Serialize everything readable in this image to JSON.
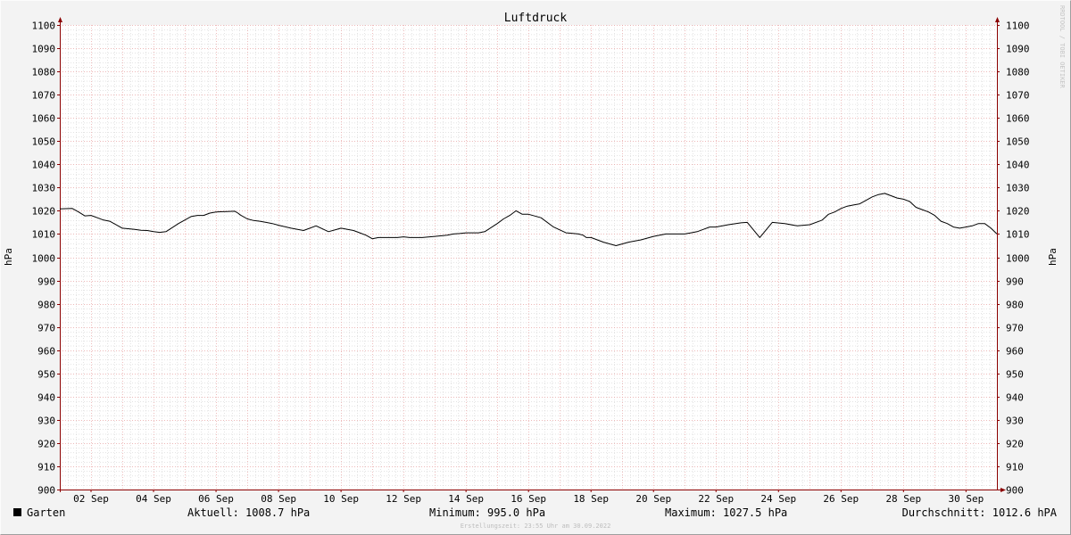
{
  "chart_data": {
    "type": "line",
    "title": "Luftdruck",
    "ylabel": "hPa",
    "ylabel_right": "hPa",
    "ylim": [
      900,
      1100
    ],
    "y_ticks": [
      900,
      910,
      920,
      930,
      940,
      950,
      960,
      970,
      980,
      990,
      1000,
      1010,
      1020,
      1030,
      1040,
      1050,
      1060,
      1070,
      1080,
      1090,
      1100
    ],
    "x_ticks": [
      "02 Sep",
      "04 Sep",
      "06 Sep",
      "08 Sep",
      "10 Sep",
      "12 Sep",
      "14 Sep",
      "16 Sep",
      "18 Sep",
      "20 Sep",
      "22 Sep",
      "24 Sep",
      "26 Sep",
      "28 Sep",
      "30 Sep"
    ],
    "x_tick_days": [
      2,
      4,
      6,
      8,
      10,
      12,
      14,
      16,
      18,
      20,
      22,
      24,
      26,
      28,
      30
    ],
    "xlim_days": [
      1.0,
      30.99
    ],
    "grid": true,
    "colors": {
      "line": "#000000",
      "major_grid": "#e8a2a2",
      "minor_grid": "#c8c8c8",
      "axis": "#8b0000",
      "plot_bg": "#ffffff",
      "canvas_bg": "#f3f3f3"
    },
    "series": [
      {
        "name": "Garten",
        "day": [
          1.0,
          1.4,
          1.6,
          1.8,
          2.0,
          2.2,
          2.4,
          2.6,
          3.0,
          3.4,
          3.6,
          3.8,
          4.0,
          4.2,
          4.4,
          4.8,
          5.2,
          5.4,
          5.6,
          5.8,
          6.0,
          6.2,
          6.6,
          6.7,
          6.75,
          6.8,
          7.0,
          7.2,
          7.4,
          7.6,
          7.8,
          8.0,
          8.4,
          8.8,
          9.2,
          9.6,
          10.0,
          10.4,
          10.6,
          10.8,
          11.0,
          11.2,
          11.4,
          11.6,
          11.8,
          12.0,
          12.2,
          12.4,
          12.6,
          12.8,
          13.0,
          13.4,
          13.6,
          13.8,
          14.0,
          14.2,
          14.4,
          14.6,
          15.0,
          15.2,
          15.4,
          15.6,
          15.8,
          16.0,
          16.4,
          16.8,
          17.2,
          17.6,
          17.75,
          17.8,
          17.85,
          18.0,
          18.4,
          18.8,
          19.2,
          19.6,
          20.0,
          20.4,
          20.8,
          21.0,
          21.2,
          21.4,
          21.6,
          21.8,
          22.0,
          22.4,
          22.8,
          23.0,
          23.4,
          23.8,
          24.2,
          24.6,
          25.0,
          25.4,
          25.6,
          25.8,
          26.0,
          26.2,
          26.4,
          26.6,
          26.8,
          27.0,
          27.2,
          27.4,
          27.6,
          27.8,
          28.0,
          28.2,
          28.4,
          28.6,
          28.8,
          29.0,
          29.2,
          29.4,
          29.6,
          29.8,
          30.0,
          30.2,
          30.4,
          30.6,
          30.8,
          30.99
        ],
        "values": [
          1020.8,
          1021.0,
          1019.5,
          1017.8,
          1018.0,
          1017.0,
          1016.0,
          1015.5,
          1012.5,
          1012.0,
          1011.6,
          1011.5,
          1011.0,
          1010.7,
          1011.0,
          1014.5,
          1017.5,
          1018.0,
          1018.0,
          1019.0,
          1019.5,
          1019.6,
          1019.8,
          1019.0,
          1018.5,
          1018.0,
          1016.5,
          1015.8,
          1015.5,
          1015.0,
          1014.5,
          1013.8,
          1012.5,
          1011.5,
          1013.5,
          1011.0,
          1012.5,
          1011.5,
          1010.5,
          1009.5,
          1008.0,
          1008.5,
          1008.5,
          1008.5,
          1008.5,
          1008.8,
          1008.5,
          1008.5,
          1008.5,
          1008.7,
          1009.0,
          1009.5,
          1010.0,
          1010.2,
          1010.5,
          1010.5,
          1010.5,
          1011.0,
          1014.5,
          1016.5,
          1018.0,
          1020.0,
          1018.5,
          1018.5,
          1017.0,
          1013.0,
          1010.5,
          1010.0,
          1009.5,
          1009.0,
          1008.5,
          1008.5,
          1006.5,
          1005.0,
          1006.5,
          1007.5,
          1009.0,
          1010.0,
          1010.0,
          1010.0,
          1010.5,
          1011.0,
          1012.0,
          1013.0,
          1013.0,
          1014.0,
          1014.8,
          1015.0,
          1008.5,
          1015.0,
          1014.5,
          1013.5,
          1014.0,
          1016.0,
          1018.5,
          1019.5,
          1021.0,
          1022.0,
          1022.5,
          1023.0,
          1024.5,
          1026.0,
          1027.0,
          1027.5,
          1026.5,
          1025.5,
          1025.0,
          1024.0,
          1021.5,
          1020.5,
          1019.5,
          1018.0,
          1015.5,
          1014.5,
          1013.0,
          1012.5,
          1013.0,
          1013.5,
          1014.5,
          1014.5,
          1012.5,
          1010.0
        ]
      }
    ],
    "legend": {
      "series_label": "Garten",
      "stats": [
        "Aktuell: 1008.7 hPa",
        "Minimum: 995.0 hPa",
        "Maximum: 1027.5 hPa",
        "Durchschnitt: 1012.6 hPA"
      ]
    },
    "footer": "Erstellungszeit: 23:55 Uhr am 30.09.2022",
    "watermark": "RRDTOOL / TOBI OETIKER"
  }
}
